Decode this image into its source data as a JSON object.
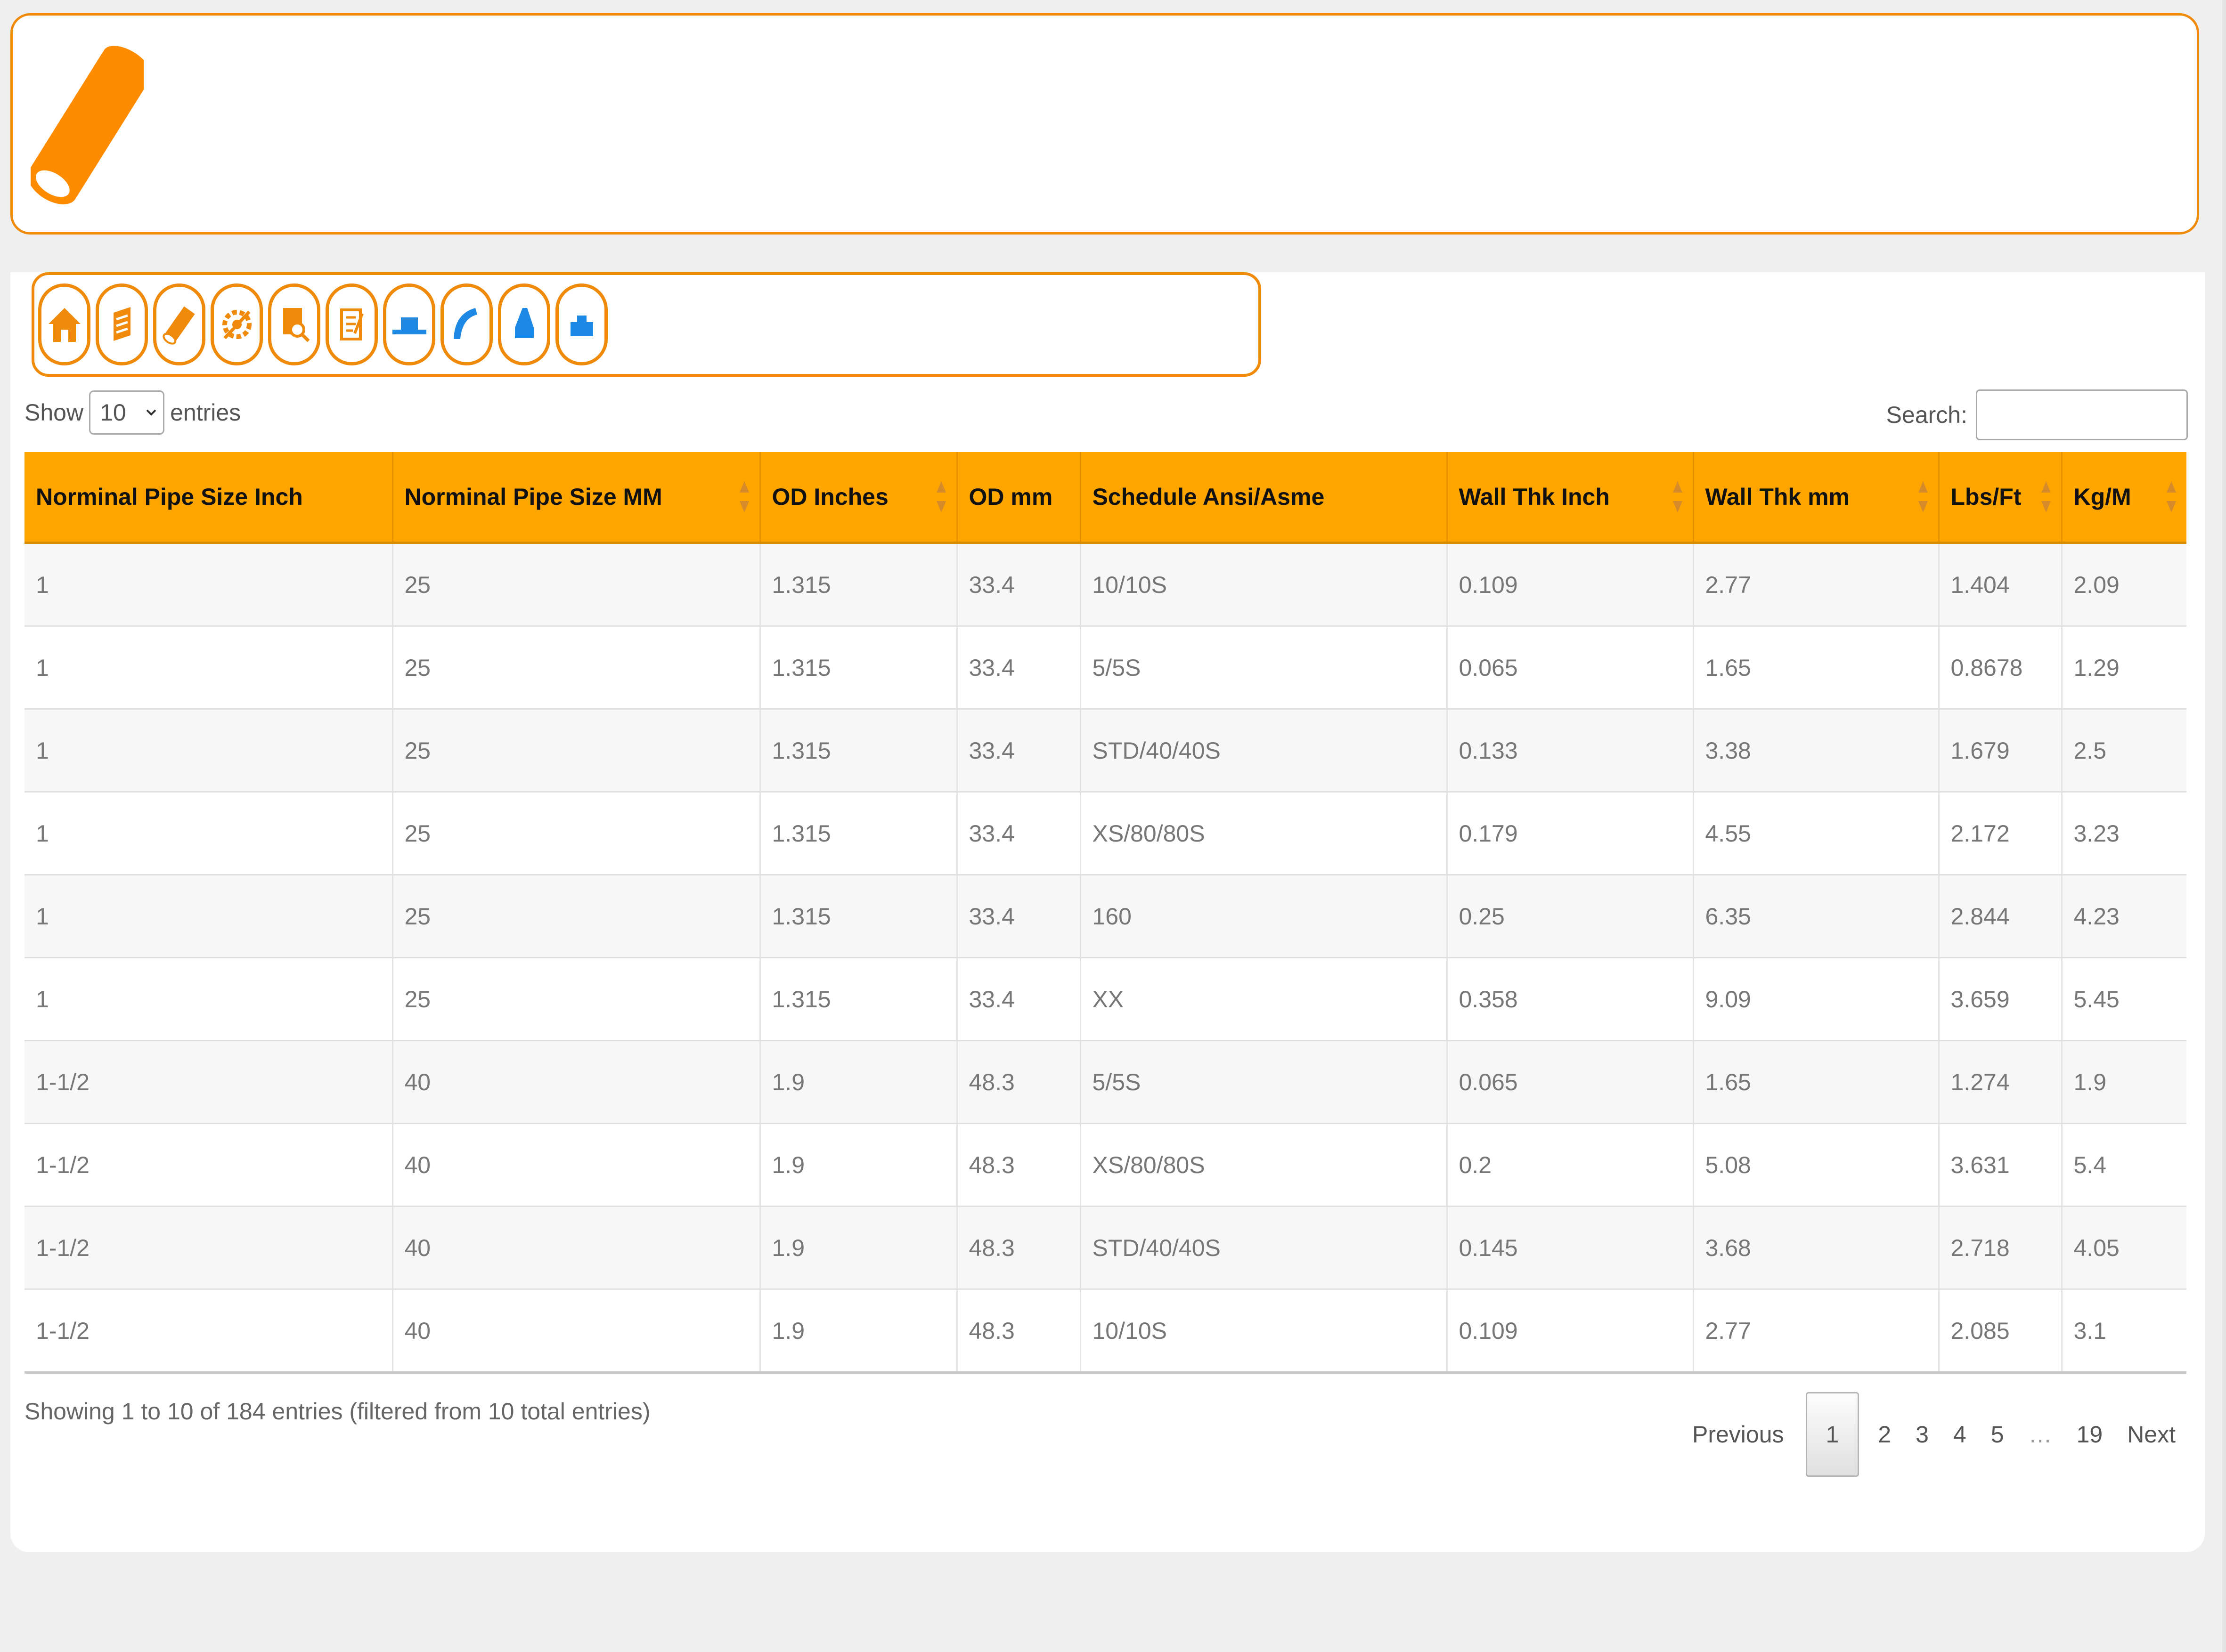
{
  "banner": {
    "logo_icon": "pipe-icon",
    "accent_color": "#f08a0a"
  },
  "toolbar": {
    "icons": [
      "home-icon",
      "flange-icon",
      "pipe-icon",
      "gear-tools-icon",
      "inspection-icon",
      "document-icon",
      "pipe-cap-icon",
      "pipe-elbow-icon",
      "reducer-icon",
      "tee-icon"
    ]
  },
  "length_menu": {
    "show_label": "Show",
    "selected": "10",
    "entries_label": "entries"
  },
  "search": {
    "label": "Search:",
    "value": ""
  },
  "table": {
    "header_color": "#ffa500",
    "columns": [
      "Norminal Pipe Size Inch",
      "Norminal Pipe Size MM",
      "OD Inches",
      "OD mm",
      "Schedule Ansi/Asme",
      "Wall Thk Inch",
      "Wall Thk mm",
      "Lbs/Ft",
      "Kg/M"
    ],
    "rows": [
      [
        "1",
        "25",
        "1.315",
        "33.4",
        "10/10S",
        "0.109",
        "2.77",
        "1.404",
        "2.09"
      ],
      [
        "1",
        "25",
        "1.315",
        "33.4",
        "5/5S",
        "0.065",
        "1.65",
        "0.8678",
        "1.29"
      ],
      [
        "1",
        "25",
        "1.315",
        "33.4",
        "STD/40/40S",
        "0.133",
        "3.38",
        "1.679",
        "2.5"
      ],
      [
        "1",
        "25",
        "1.315",
        "33.4",
        "XS/80/80S",
        "0.179",
        "4.55",
        "2.172",
        "3.23"
      ],
      [
        "1",
        "25",
        "1.315",
        "33.4",
        "160",
        "0.25",
        "6.35",
        "2.844",
        "4.23"
      ],
      [
        "1",
        "25",
        "1.315",
        "33.4",
        "XX",
        "0.358",
        "9.09",
        "3.659",
        "5.45"
      ],
      [
        "1-1/2",
        "40",
        "1.9",
        "48.3",
        "5/5S",
        "0.065",
        "1.65",
        "1.274",
        "1.9"
      ],
      [
        "1-1/2",
        "40",
        "1.9",
        "48.3",
        "XS/80/80S",
        "0.2",
        "5.08",
        "3.631",
        "5.4"
      ],
      [
        "1-1/2",
        "40",
        "1.9",
        "48.3",
        "STD/40/40S",
        "0.145",
        "3.68",
        "2.718",
        "4.05"
      ],
      [
        "1-1/2",
        "40",
        "1.9",
        "48.3",
        "10/10S",
        "0.109",
        "2.77",
        "2.085",
        "3.1"
      ]
    ]
  },
  "info": "Showing 1 to 10 of 184 entries (filtered from 10 total entries)",
  "pagination": {
    "previous": "Previous",
    "pages": [
      "1",
      "2",
      "3",
      "4",
      "5",
      "…",
      "19"
    ],
    "current": "1",
    "next": "Next"
  }
}
